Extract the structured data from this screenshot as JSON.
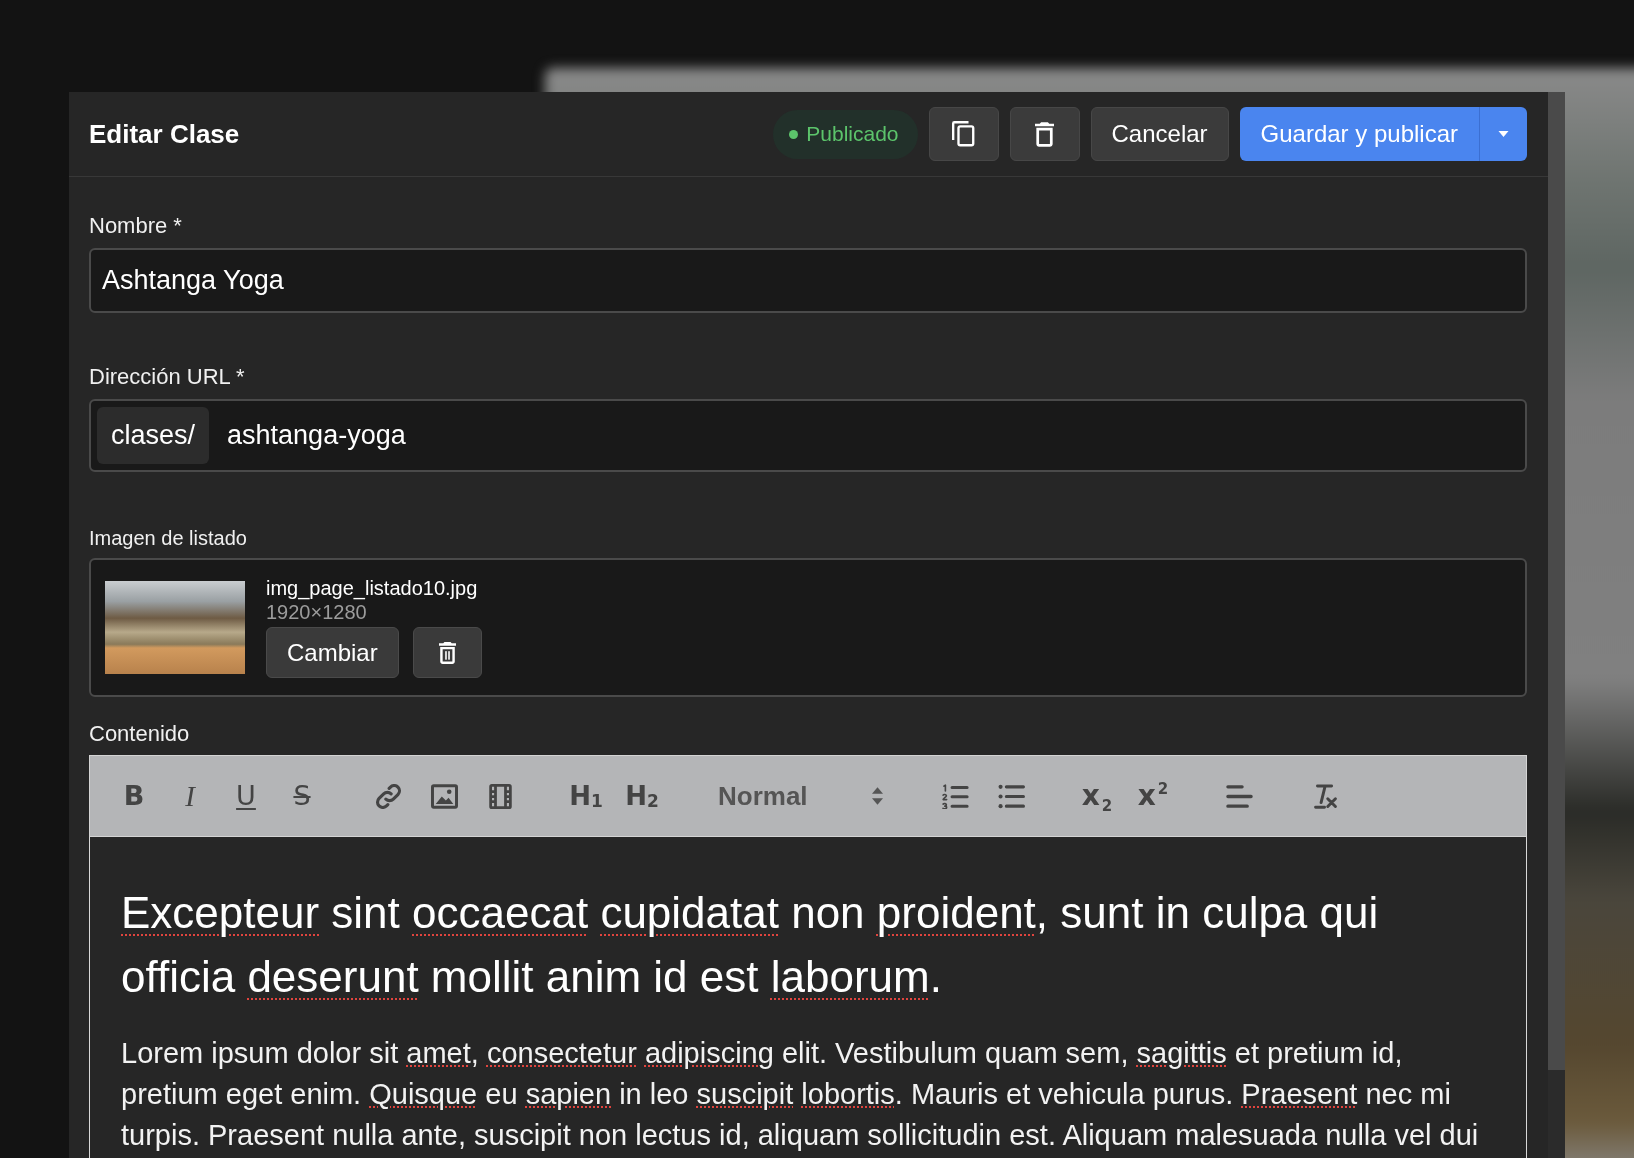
{
  "dialog": {
    "title": "Editar Clase",
    "status": {
      "kind": "published",
      "label": "Publicado"
    },
    "actions": [
      {
        "kind": "duplicate"
      },
      {
        "kind": "delete"
      },
      {
        "kind": "cancel",
        "label": "Cancelar"
      }
    ],
    "primary_action": {
      "label": "Guardar y publicar",
      "has_menu": true
    }
  },
  "form": {
    "fields": [
      {
        "kind": "text",
        "label": "Nombre *",
        "value": "Ashtanga Yoga"
      },
      {
        "kind": "url",
        "label": "Dirección URL *",
        "prefix": "clases/",
        "value": "ashtanga-yoga"
      }
    ],
    "listing_image": {
      "label": "Imagen de listado",
      "file_name": "img_page_listado10.jpg",
      "dimensions": "1920×1280",
      "actions": [
        {
          "kind": "change",
          "label": "Cambiar"
        },
        {
          "kind": "delete"
        }
      ]
    },
    "content": {
      "label": "Contenido",
      "toolbar": [
        [
          {
            "kind": "bold",
            "label": "B"
          },
          {
            "kind": "italic",
            "label": "I"
          },
          {
            "kind": "underline",
            "label": "U"
          },
          {
            "kind": "strike",
            "label": "S"
          }
        ],
        [
          {
            "kind": "link"
          },
          {
            "kind": "image"
          },
          {
            "kind": "video"
          }
        ],
        [
          {
            "kind": "heading",
            "label": "H$_{1}$"
          },
          {
            "kind": "heading",
            "label": "H$_{2}$"
          }
        ],
        [
          {
            "kind": "select",
            "label": "Normal"
          }
        ],
        [
          {
            "kind": "ordered-list"
          },
          {
            "kind": "bullet-list"
          }
        ],
        [
          {
            "kind": "subscript",
            "label": "x$_{2}$"
          },
          {
            "kind": "superscript",
            "label": "x$^{2}$"
          }
        ],
        [
          {
            "kind": "align"
          }
        ],
        [
          {
            "kind": "clean"
          }
        ]
      ],
      "heading": [
        {
          "text": "Excepteur",
          "misspelled": true
        },
        {
          "text": " sint ",
          "misspelled": false
        },
        {
          "text": "occaecat cupidatat",
          "misspelled": true
        },
        {
          "text": " non ",
          "misspelled": false
        },
        {
          "text": "proident",
          "misspelled": true
        },
        {
          "text": ", sunt in culpa qui officia ",
          "misspelled": false
        },
        {
          "text": "deserunt",
          "misspelled": true
        },
        {
          "text": " mollit anim id est ",
          "misspelled": false
        },
        {
          "text": "laborum",
          "misspelled": true
        },
        {
          "text": ".",
          "misspelled": false
        }
      ],
      "paragraph": [
        {
          "text": "Lorem ipsum dolor sit ",
          "misspelled": false
        },
        {
          "text": "amet",
          "misspelled": true
        },
        {
          "text": ", ",
          "misspelled": false
        },
        {
          "text": "consectetur adipiscing",
          "misspelled": true
        },
        {
          "text": " elit. Vestibulum quam sem, ",
          "misspelled": false
        },
        {
          "text": "sagittis",
          "misspelled": true
        },
        {
          "text": " et pretium id, pretium eget enim. ",
          "misspelled": false
        },
        {
          "text": "Quisque",
          "misspelled": true
        },
        {
          "text": " eu ",
          "misspelled": false
        },
        {
          "text": "sapien",
          "misspelled": true
        },
        {
          "text": " in leo ",
          "misspelled": false
        },
        {
          "text": "suscipit lobortis",
          "misspelled": true
        },
        {
          "text": ". Mauris et vehicula purus. ",
          "misspelled": false
        },
        {
          "text": "Praesent",
          "misspelled": true
        },
        {
          "text": " nec mi turpis. Praesent nulla ante, suscipit non lectus id, aliquam sollicitudin est. Aliquam malesuada nulla vel dui",
          "misspelled": false
        }
      ]
    }
  }
}
